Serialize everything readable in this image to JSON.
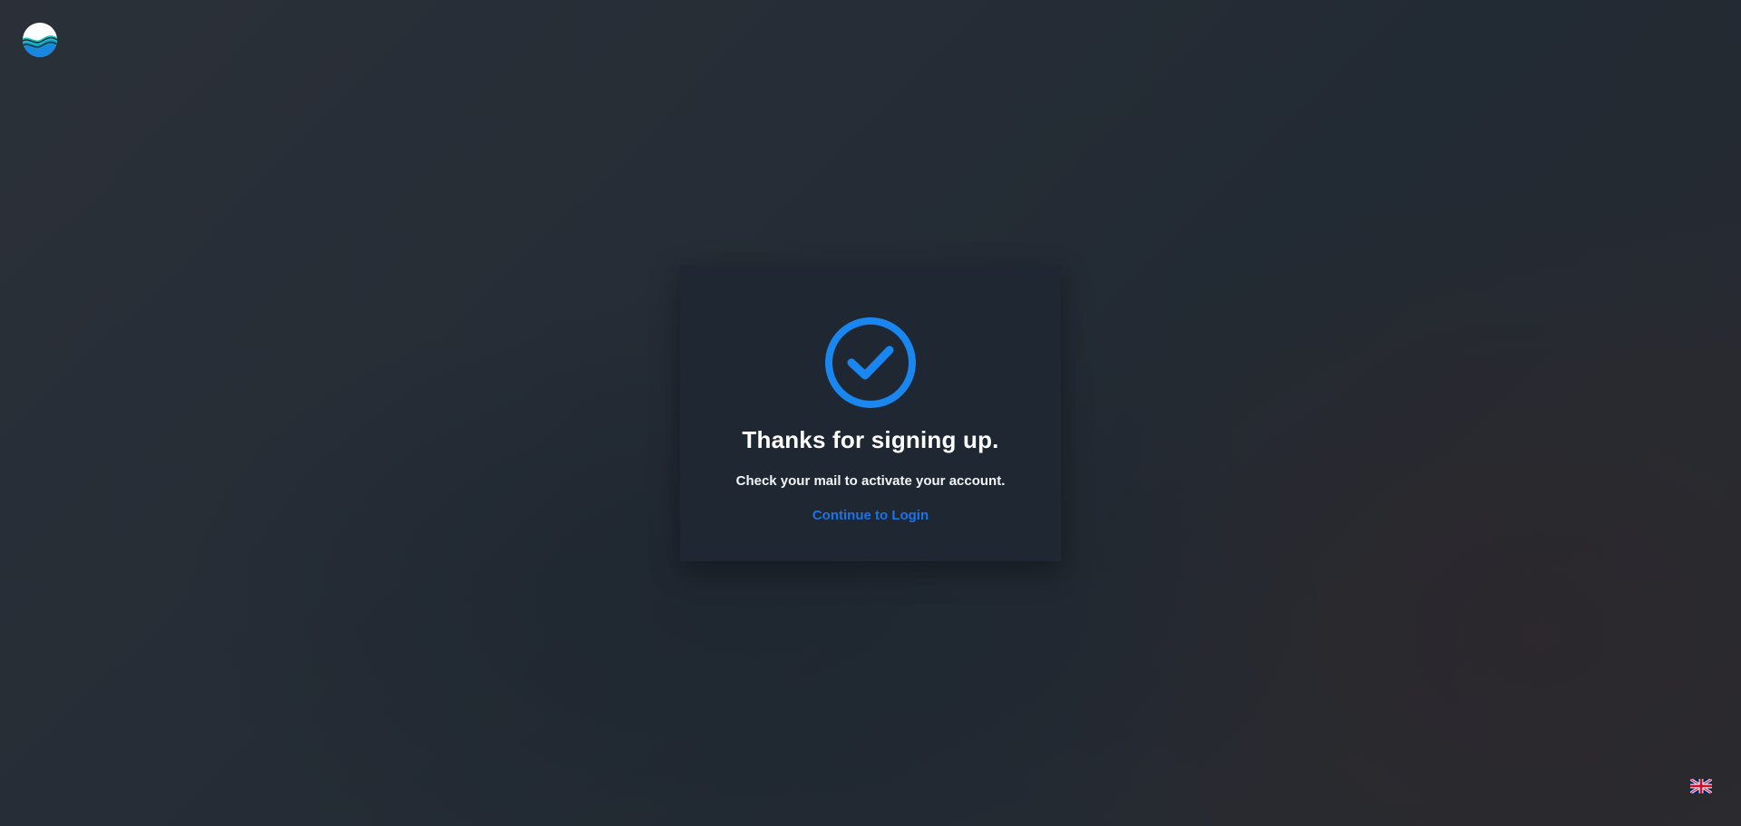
{
  "brand": {
    "logo_icon": "wave-globe-logo",
    "colors": {
      "logo_top": "#ffffff",
      "logo_waves": "#1fb6c9",
      "logo_bottom": "#1a86e0"
    }
  },
  "confirmation": {
    "icon": "check-circle-icon",
    "title": "Thanks for signing up.",
    "message": "Check your mail to activate your account.",
    "login_link": "Continue to Login"
  },
  "language": {
    "icon": "uk-flag-icon",
    "selected": "English"
  },
  "theme": {
    "accent": "#1a73e8",
    "check_color": "#1a86f0",
    "card_bg": "#1f2832",
    "text_color": "#ffffff"
  }
}
